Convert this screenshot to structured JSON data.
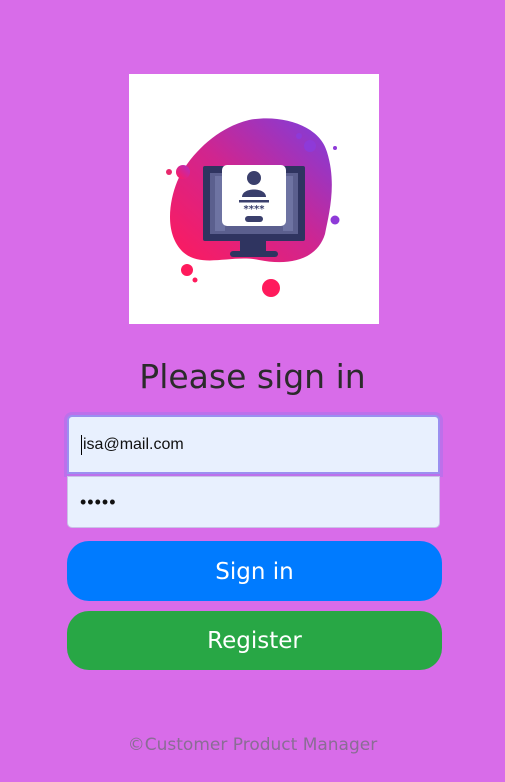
{
  "logo": {
    "icon": "login-monitor-illustration",
    "password_mask": "****"
  },
  "heading": "Please sign in",
  "form": {
    "email_value": "isa@mail.com",
    "password_mask": "•••••"
  },
  "buttons": {
    "signin_label": "Sign in",
    "register_label": "Register"
  },
  "footer": "©Customer Product Manager",
  "colors": {
    "background": "#d86ce9",
    "signin": "#007bff",
    "register": "#28a745",
    "input_bg": "#e8f0fe"
  }
}
